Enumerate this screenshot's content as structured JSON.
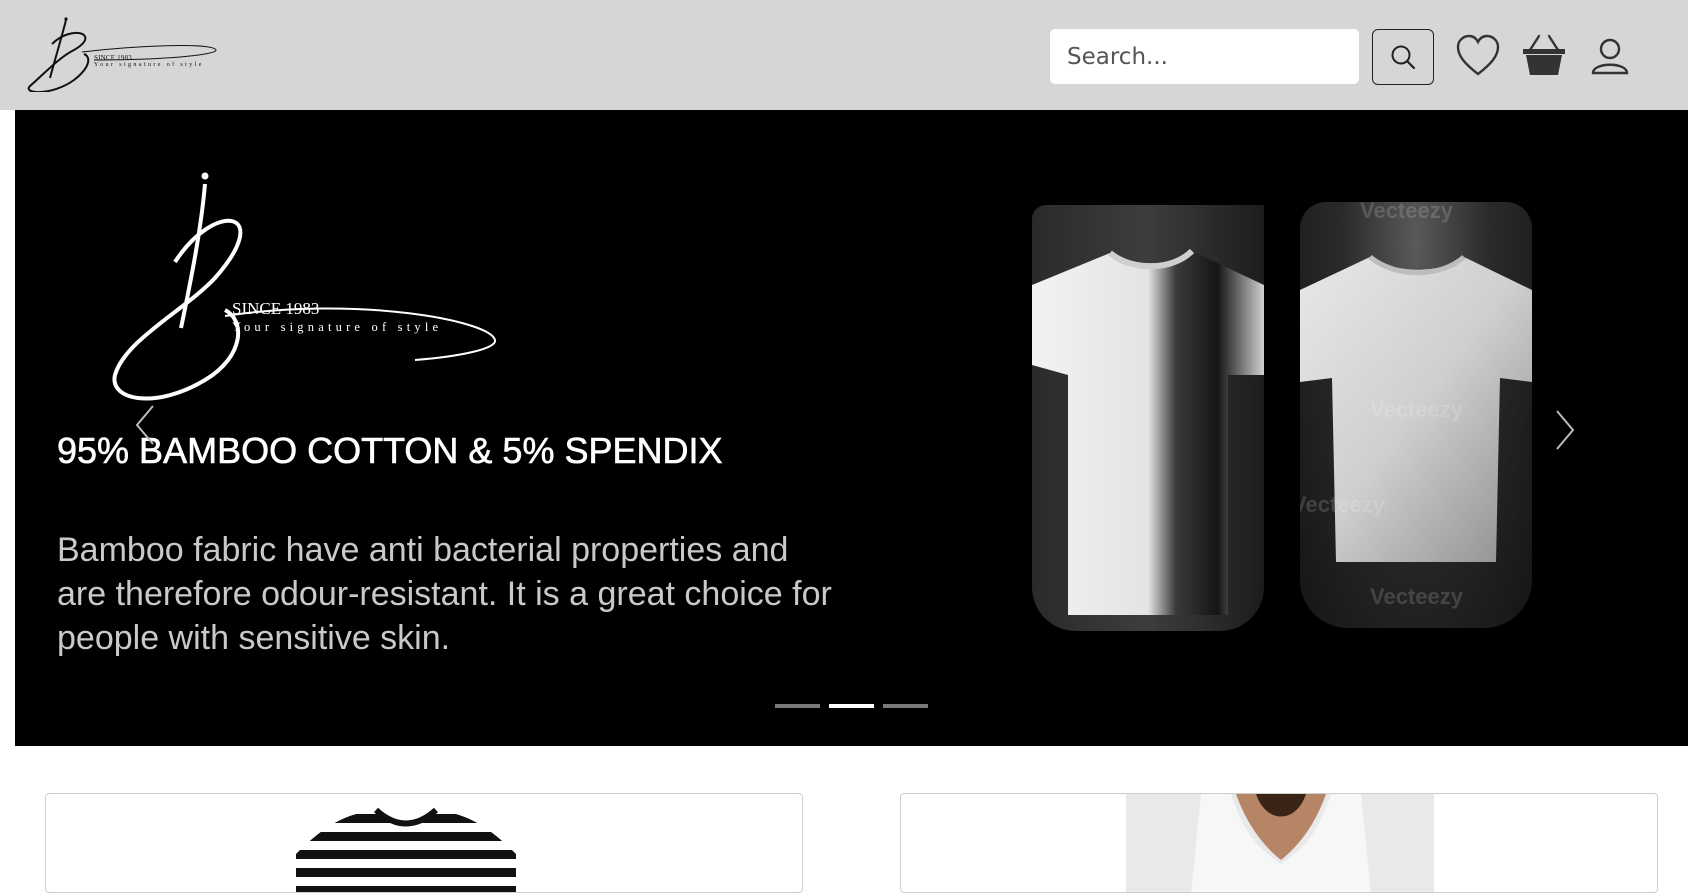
{
  "brand": {
    "since": "SINCE 1983",
    "tagline": "Your signature of style"
  },
  "header": {
    "search_placeholder": "Search...",
    "icons": [
      "search-icon",
      "heart-icon",
      "basket-icon",
      "user-icon"
    ]
  },
  "hero": {
    "since": "SINCE 1983",
    "tagline": "Your signature of style",
    "heading": "95% BAMBOO COTTON & 5% SPENDIX",
    "description": "Bamboo fabric have anti bacterial properties and are therefore odour-resistant. It is a great choice for people with sensitive skin.",
    "watermark": "Vecteezy",
    "slides_count": 3,
    "active_slide": 2
  },
  "colors": {
    "header_bg": "#d6d6d6",
    "hero_bg": "#000000",
    "indicator_active": "#ffffff",
    "indicator_inactive": "#7a7a7a"
  }
}
